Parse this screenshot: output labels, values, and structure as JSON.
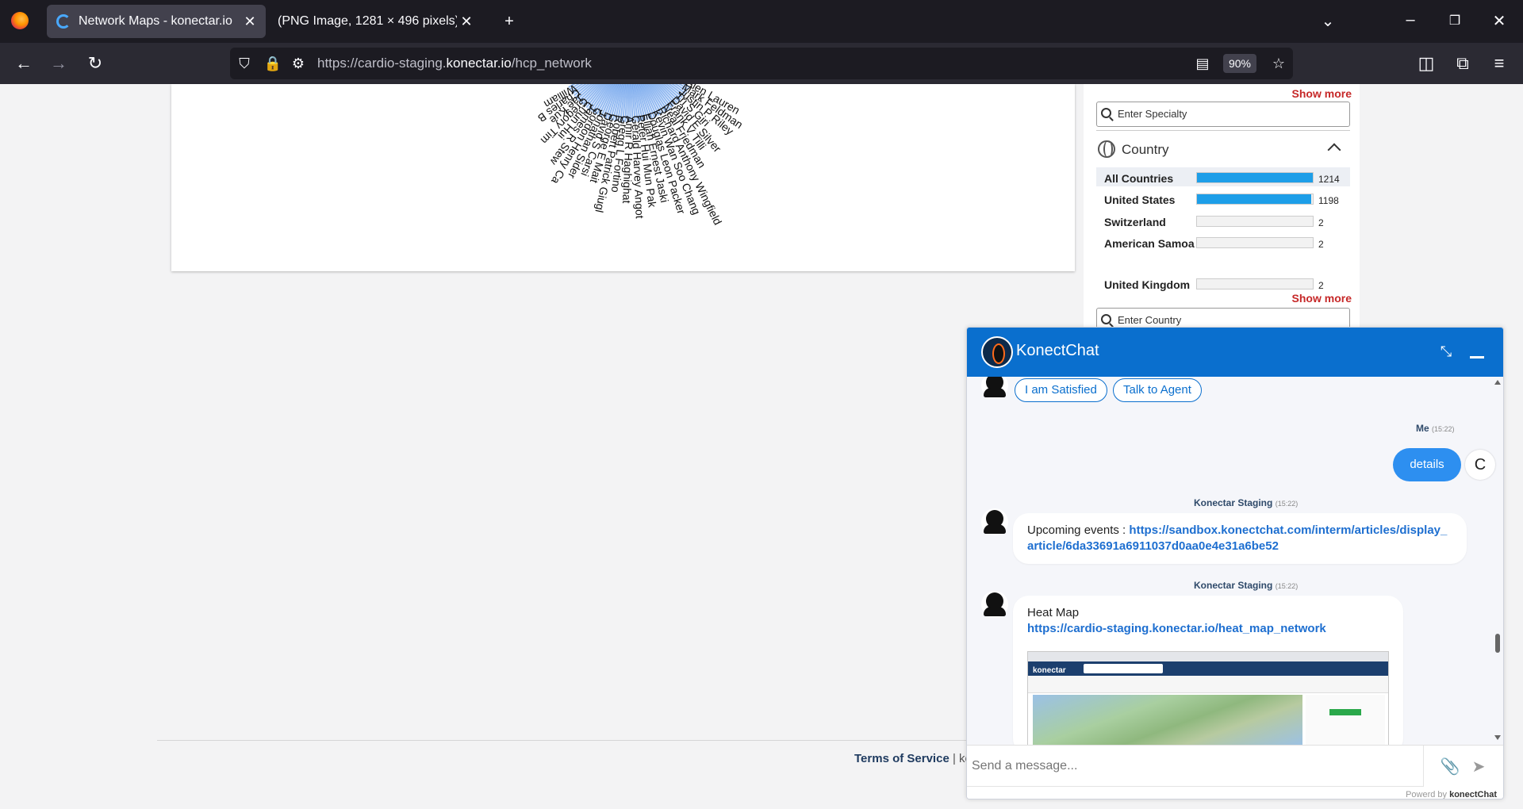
{
  "browser": {
    "tabs": [
      {
        "title": "Network Maps - konectar.io",
        "active": true
      },
      {
        "title": "(PNG Image, 1281 × 496 pixels)",
        "active": false
      }
    ],
    "url_prefix": "https://cardio-staging.",
    "url_domain": "konectar.io",
    "url_path": "/hcp_network",
    "zoom": "90%",
    "icons": [
      "firefox-icon",
      "new-tab-icon",
      "tab-list-icon",
      "minimize-icon",
      "restore-icon",
      "close-icon",
      "back-icon",
      "forward-icon",
      "reload-icon",
      "shield-icon",
      "lock-icon",
      "permissions-icon",
      "reader-view-icon",
      "bookmark-star-icon",
      "pocket-icon",
      "extensions-icon",
      "menu-icon"
    ]
  },
  "network": {
    "names": [
      "William",
      "Charles B",
      "Jae Kue",
      "Gregory Tim",
      "Chun Hui",
      "James R Stew",
      "Gordon Henry Ca",
      "Jonathan Sider",
      "David S Carsi",
      "George E Mait",
      "Robert Patrick Giugl",
      "Gregg L Fortino",
      "Amir R Haghighat",
      "Gerald Harvey Angot",
      "Peter Hui Mun Pak",
      "Elijah Ernest Jaski",
      "Douglas Leon Packer",
      "Kevin Wan Soo Chang",
      "Richard Anthony Wingfield",
      "Neal Friedman",
      "Frank V Tilli",
      "David E Silver",
      "Tri S Giri",
      "Justin P Riley",
      "Mark Feldman",
      "Glen Lauren"
    ],
    "accent": "#3b82e6"
  },
  "filters": {
    "show_more": "Show more",
    "specialty_placeholder": "Enter Specialty",
    "country_title": "Country",
    "country_placeholder": "Enter Country",
    "countries": [
      {
        "name": "All Countries",
        "count": "1214",
        "fraction": 1.0,
        "selected": true
      },
      {
        "name": "United States",
        "count": "1198",
        "fraction": 0.987,
        "selected": false
      },
      {
        "name": "Switzerland",
        "count": "2",
        "fraction": 0.0,
        "selected": false
      },
      {
        "name": "American Samoa",
        "count": "2",
        "fraction": 0.0,
        "selected": false
      },
      {
        "name": "United Kingdom",
        "count": "2",
        "fraction": 0.0,
        "selected": false
      }
    ],
    "bar_color": "#1d9ee8"
  },
  "footer": {
    "terms": "Terms of Service",
    "rest": "| ko"
  },
  "chat": {
    "title": "KonectChat",
    "quick_replies": [
      "I am Satisfied",
      "Talk to Agent"
    ],
    "user_name": "Me",
    "user_time": "(15:22)",
    "user_message": "details",
    "user_avatar": "C",
    "bot_name": "Konectar Staging",
    "bot_time": "(15:22)",
    "msg1_label": "Upcoming events : ",
    "msg1_link": "https://sandbox.konectchat.com/interm/articles/display_article/6da33691a6911037d0aa0e4e31a6be52",
    "msg2_label": "Heat Map",
    "msg2_link": "https://cardio-staging.konectar.io/heat_map_network",
    "preview_logo": "konectar",
    "input_placeholder": "Send a message...",
    "powered_prefix": "Powerd by ",
    "powered_brand": "konectChat",
    "header_color": "#0a6fce"
  }
}
